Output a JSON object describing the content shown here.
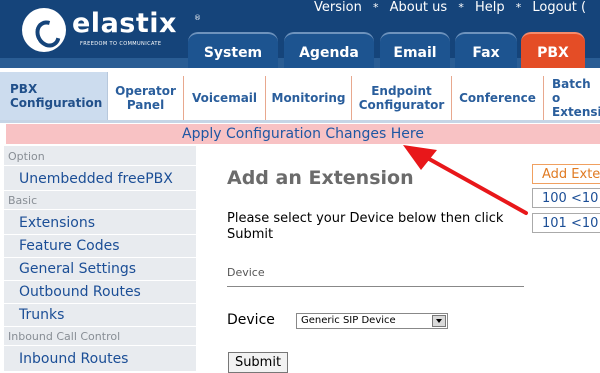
{
  "header": {
    "logo_name": "elastix",
    "logo_registered": "®",
    "logo_tagline": "FREEDOM TO COMMUNICATE",
    "top_links": [
      "Version",
      "About us",
      "Help",
      "Logout ("
    ],
    "separator": "*",
    "tabs": [
      {
        "label": "System"
      },
      {
        "label": "Agenda"
      },
      {
        "label": "Email"
      },
      {
        "label": "Fax"
      },
      {
        "label": "PBX",
        "active": true
      }
    ],
    "active_tab_color": "#e44d26",
    "header_color": "#15447a"
  },
  "subtabs": [
    {
      "line1": "PBX",
      "line2": "Configuration",
      "active": true
    },
    {
      "line1": "Operator",
      "line2": "Panel"
    },
    {
      "line1": "Voicemail",
      "line2": ""
    },
    {
      "line1": "Monitoring",
      "line2": ""
    },
    {
      "line1": "Endpoint",
      "line2": "Configurator"
    },
    {
      "line1": "Conference",
      "line2": ""
    },
    {
      "line1": "Batch o",
      "line2": "Extensi"
    }
  ],
  "apply_bar": {
    "label": "Apply Configuration Changes Here",
    "color": "#f8c2c4"
  },
  "sidebar": {
    "sections": [
      {
        "heading": "Option",
        "items": [
          "Unembedded freePBX"
        ]
      },
      {
        "heading": "Basic",
        "items": [
          "Extensions",
          "Feature Codes",
          "General Settings",
          "Outbound Routes",
          "Trunks"
        ]
      },
      {
        "heading": "Inbound Call Control",
        "items": [
          "Inbound Routes"
        ]
      }
    ]
  },
  "content": {
    "title": "Add an Extension",
    "instructions": "Please select your Device below then click Submit",
    "device_heading": "Device",
    "device_label": "Device",
    "device_value": "Generic SIP Device",
    "submit_label": "Submit"
  },
  "extension_list": {
    "add_label": "Add Exte",
    "items": [
      "100 <10",
      "101 <10"
    ]
  },
  "annotation_arrow_color": "#e8171a"
}
